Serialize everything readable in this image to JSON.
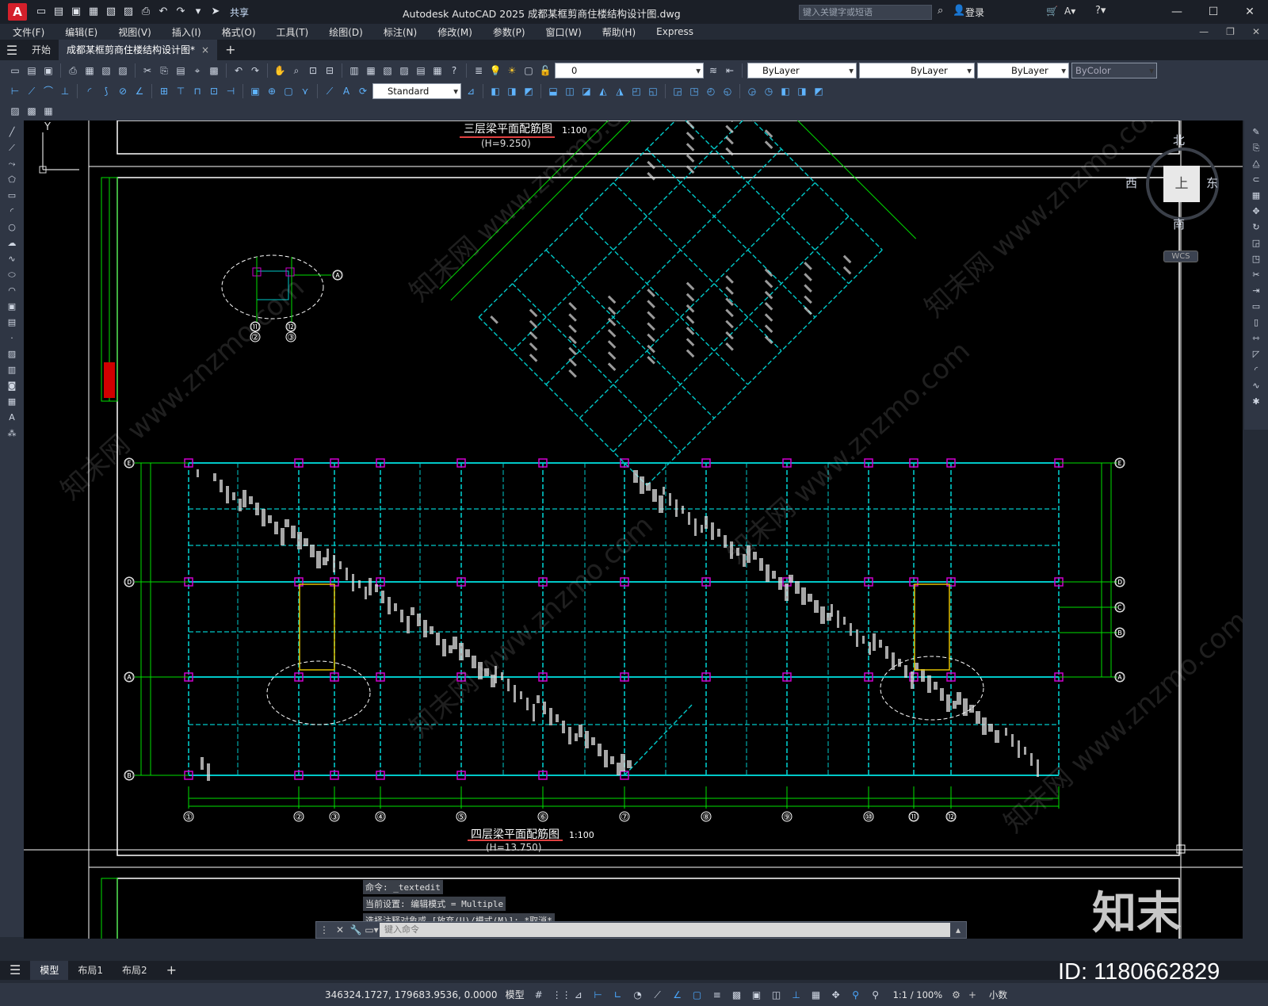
{
  "app": {
    "window_title": "Autodesk AutoCAD 2025    成都某框剪商住楼结构设计图.dwg",
    "logo_letter": "A",
    "share_label": "共享",
    "search_placeholder": "键入关键字或短语",
    "login_label": "登录"
  },
  "menu": {
    "items": [
      "文件(F)",
      "编辑(E)",
      "视图(V)",
      "插入(I)",
      "格式(O)",
      "工具(T)",
      "绘图(D)",
      "标注(N)",
      "修改(M)",
      "参数(P)",
      "窗口(W)",
      "帮助(H)",
      "Express"
    ]
  },
  "tabs": {
    "start": "开始",
    "document": "成都某框剪商住楼结构设计图*",
    "close": "×",
    "new": "+"
  },
  "toolbar": {
    "layer_value": "0",
    "color_value": "ByLayer",
    "linetype_value": "ByLayer",
    "lineweight_value": "ByLayer",
    "plotstyle_value": "ByColor",
    "textstyle_value": "Standard"
  },
  "drawing": {
    "top_title": "三层梁平面配筋图",
    "top_sub": "(H=9.250)",
    "bottom_title": "四层梁平面配筋图",
    "bottom_sub": "(H=13.750)",
    "scale": "1:100",
    "axis_bottom": [
      "①",
      "②",
      "③",
      "④",
      "⑤",
      "⑥",
      "⑦",
      "⑧",
      "⑨",
      "⑩",
      "⑪",
      "⑫"
    ],
    "axis_left": [
      "Ⓔ",
      "Ⓓ",
      "Ⓐ",
      "Ⓑ"
    ],
    "axis_right": [
      "Ⓔ",
      "Ⓓ",
      "Ⓒ",
      "Ⓑ",
      "Ⓐ"
    ],
    "detail_axis": [
      "Ⓐ",
      "⑪",
      "②",
      "⑫",
      "③"
    ]
  },
  "viewcube": {
    "north": "北",
    "south": "南",
    "east": "东",
    "west": "西",
    "face": "上",
    "wcs": "WCS"
  },
  "ucs": {
    "x_label": "X",
    "y_label": "Y"
  },
  "command": {
    "history": [
      "命令: _textedit",
      "当前设置: 编辑模式 = Multiple",
      "选择注释对象或 [放弃(U)/模式(M)]: *取消*"
    ],
    "placeholder": "键入命令"
  },
  "layout_tabs": [
    "模型",
    "布局1",
    "布局2"
  ],
  "status": {
    "coords": "346324.1727, 179683.9536, 0.0000",
    "mode": "模型",
    "scale": "1:1 / 100%",
    "units": "小数"
  },
  "watermark": {
    "logo": "知末",
    "id": "ID: 1180662829",
    "diag": "知末网 www.znzmo.com"
  },
  "colors": {
    "beam": "#00c8c8",
    "column": "#d000d0",
    "dimension": "#00e000",
    "canvas": "#000000"
  }
}
